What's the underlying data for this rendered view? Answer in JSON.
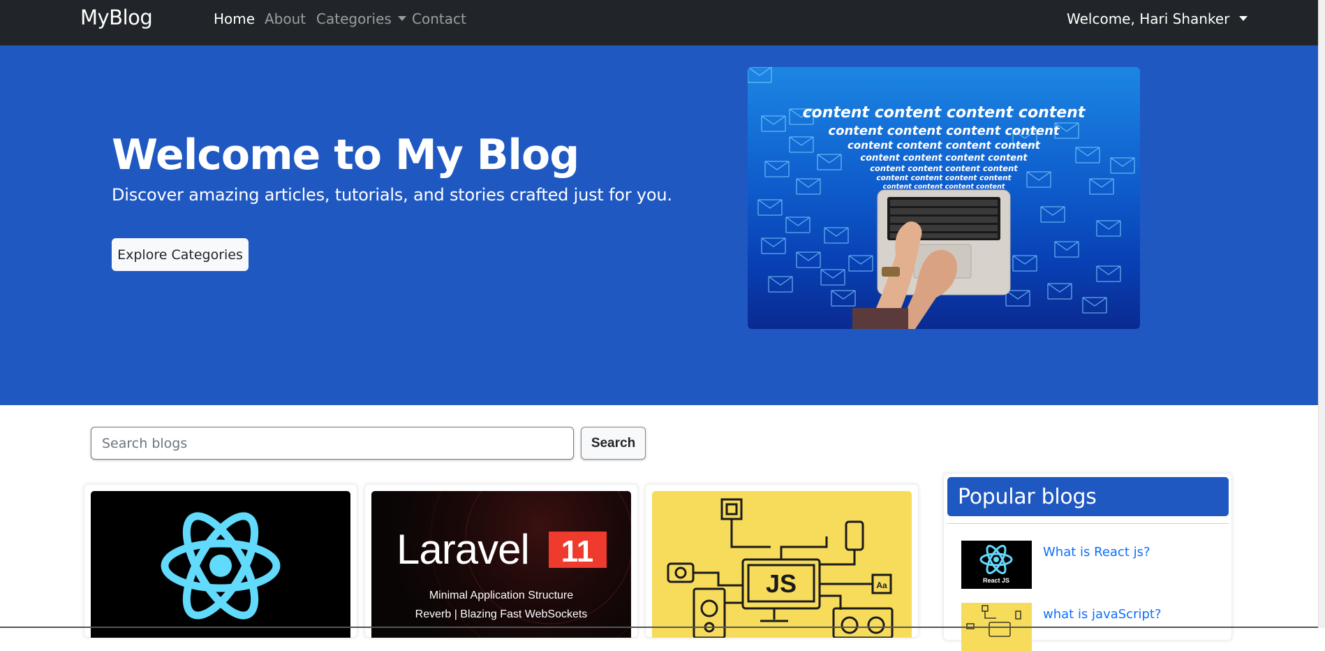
{
  "navbar": {
    "brand": "MyBlog",
    "links": [
      {
        "label": "Home",
        "active": true
      },
      {
        "label": "About",
        "active": false
      },
      {
        "label": "Categories",
        "active": false,
        "dropdown": true
      },
      {
        "label": "Contact",
        "active": false
      }
    ],
    "user_menu": "Welcome, Hari Shanker"
  },
  "hero": {
    "title": "Welcome to My Blog",
    "subtitle": "Discover amazing articles, tutorials, and stories crafted just for you.",
    "button_label": "Explore Categories",
    "image_text": "content content content content",
    "image_icon": "laptop-email-illustration"
  },
  "search": {
    "placeholder": "Search blogs",
    "value": "",
    "button_label": "Search"
  },
  "cards": [
    {
      "image": "react-logo"
    },
    {
      "image": "laravel-11-banner",
      "banner_title": "Laravel",
      "banner_version": "11",
      "banner_line1": "Minimal Application Structure",
      "banner_line2": "Reverb | Blazing Fast WebSockets"
    },
    {
      "image": "javascript-diagram",
      "badge": "JS",
      "aa": "Aa"
    }
  ],
  "sidebar": {
    "title": "Popular blogs",
    "items": [
      {
        "title": "What is React js?",
        "thumb_label": "React JS",
        "thumb_icon": "react-logo"
      },
      {
        "title": "what is javaScript?",
        "thumb_icon": "javascript-diagram"
      }
    ]
  },
  "colors": {
    "navbar_bg": "#212529",
    "hero_bg": "#2058c2",
    "link": "#0d6efd",
    "react_cyan": "#61dafb",
    "laravel_red": "#ef3b2d",
    "js_yellow": "#f7dc5c"
  }
}
